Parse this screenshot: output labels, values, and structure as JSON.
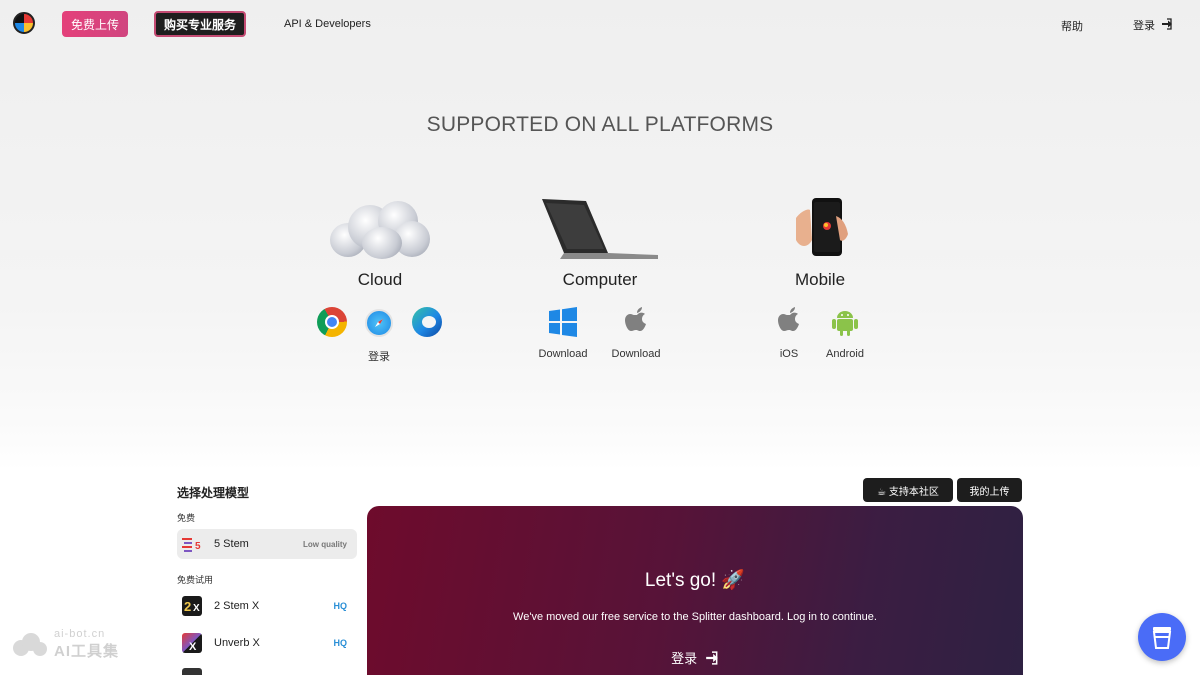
{
  "header": {
    "logo_icon": "splitter-logo-icon",
    "upload_label": "免费上传",
    "pro_label": "购买专业服务",
    "api_label": "API & Developers",
    "help_label": "帮助",
    "login_label": "登录",
    "login_icon": "sign-in-icon"
  },
  "headline": "SUPPORTED ON ALL PLATFORMS",
  "platforms": [
    {
      "title": "Cloud",
      "image": "cloud-image",
      "links": [
        {
          "label": "登录",
          "icons": [
            "chrome-icon",
            "safari-icon",
            "edge-icon"
          ]
        }
      ]
    },
    {
      "title": "Computer",
      "image": "laptop-image",
      "links": [
        {
          "label": "Download",
          "icon": "windows-icon"
        },
        {
          "label": "Download",
          "icon": "apple-icon"
        }
      ]
    },
    {
      "title": "Mobile",
      "image": "phone-image",
      "links": [
        {
          "label": "iOS",
          "icon": "apple-icon"
        },
        {
          "label": "Android",
          "icon": "android-icon"
        }
      ]
    }
  ],
  "models": {
    "heading": "选择处理模型",
    "groups": [
      {
        "label": "免费",
        "items": [
          {
            "name": "5 Stem",
            "badge": "Low quality",
            "icon": "five-stem-icon",
            "selected": true
          }
        ]
      },
      {
        "label": "免费试用",
        "items": [
          {
            "name": "2 Stem X",
            "badge": "HQ",
            "icon": "two-stem-x-icon"
          },
          {
            "name": "Unverb X",
            "badge": "HQ",
            "icon": "unverb-x-icon"
          }
        ]
      }
    ]
  },
  "actions": {
    "community_label": "☕ 支持本社区",
    "my_uploads_label": "我的上传"
  },
  "panel": {
    "title": "Let's go! 🚀",
    "message": "We've moved our free service to the Splitter dashboard. Log in to continue.",
    "login_label": "登录",
    "login_icon": "sign-in-icon"
  },
  "watermark": {
    "line1": "ai-bot.cn",
    "line2": "AI工具集"
  },
  "floating_button": {
    "icon": "coffee-cup-icon"
  },
  "colors": {
    "upload_button": "#e4407a",
    "hq_badge": "#2a8fd6",
    "coffee_button": "#4a6cf7",
    "panel_start": "#6e0b2c",
    "panel_end": "#2e2142"
  }
}
